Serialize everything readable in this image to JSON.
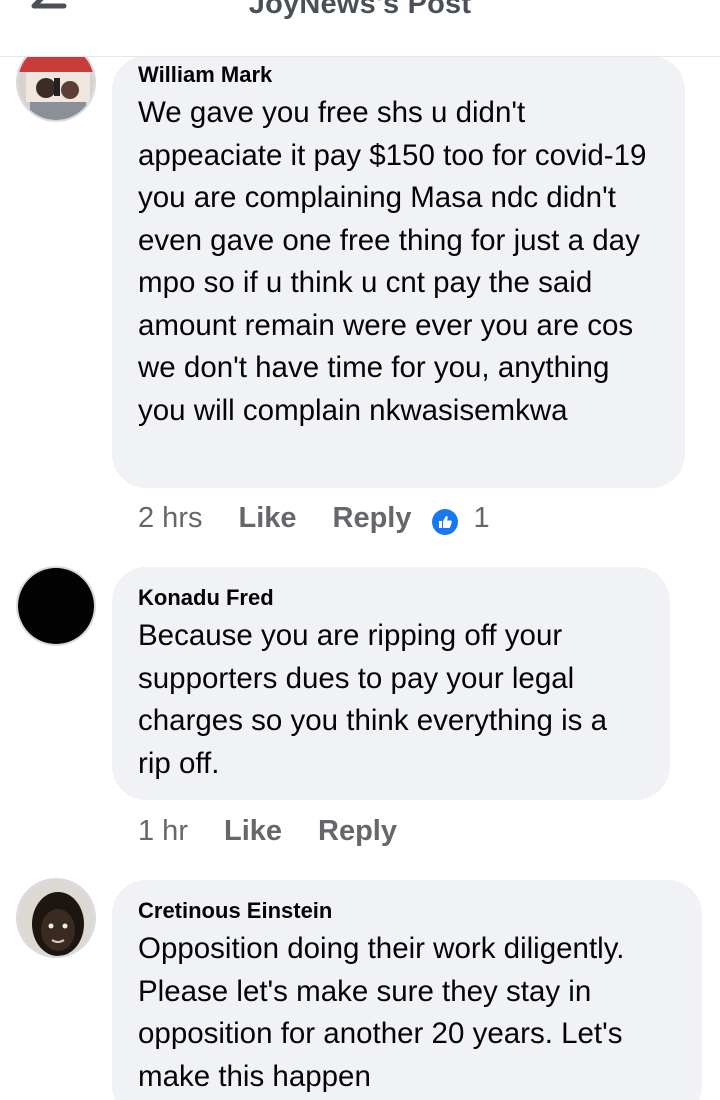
{
  "header": {
    "title": "JoyNews's Post",
    "back_icon": "arrow-left-icon"
  },
  "colors": {
    "bubble": "#f0f2f5",
    "meta": "#65676b",
    "like_badge": "#1877f2"
  },
  "comments": [
    {
      "author": "William Mark",
      "text": "We gave you free shs u didn't appeaciate it pay $150 too for covid-19 you are complaining Masa ndc didn't even gave one free thing for just a day mpo so if u think u cnt pay the said amount remain were ever you are cos we don't have time for you, anything you will complain nkwasisemkwa",
      "time": "2 hrs",
      "like_label": "Like",
      "reply_label": "Reply",
      "reaction_icon": "thumbs-up-icon",
      "reaction_count": "1"
    },
    {
      "author": "Konadu Fred",
      "text": "Because you are ripping off your supporters dues to pay your legal charges so you think everything is a rip off.",
      "time": "1 hr",
      "like_label": "Like",
      "reply_label": "Reply"
    },
    {
      "author": "Cretinous Einstein",
      "text": "Opposition doing their work diligently. Please let's make sure they stay in opposition for another 20 years. Let's make this happen"
    }
  ]
}
